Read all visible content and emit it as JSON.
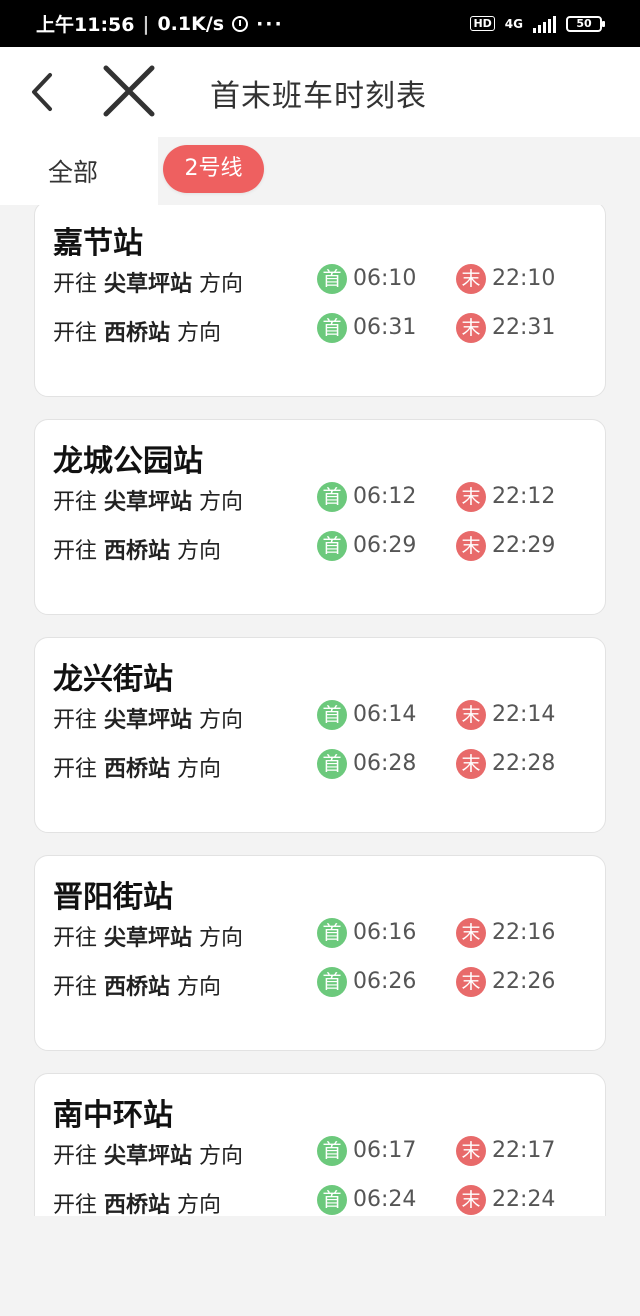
{
  "status_bar": {
    "time": "上午11:56",
    "speed": "0.1K/s",
    "dots": "···",
    "hd": "HD",
    "network": "4G",
    "battery": "50"
  },
  "header": {
    "title": "首末班车时刻表"
  },
  "tabs": [
    {
      "label": "全部",
      "active": false
    },
    {
      "label": "2号线",
      "active": true
    }
  ],
  "labels": {
    "toward": "开往",
    "direction": "方向",
    "first": "首",
    "last": "末"
  },
  "stations": [
    {
      "name": "嘉节站",
      "rows": [
        {
          "dest": "尖草坪站",
          "first": "06:10",
          "last": "22:10"
        },
        {
          "dest": "西桥站",
          "first": "06:31",
          "last": "22:31"
        }
      ]
    },
    {
      "name": "龙城公园站",
      "rows": [
        {
          "dest": "尖草坪站",
          "first": "06:12",
          "last": "22:12"
        },
        {
          "dest": "西桥站",
          "first": "06:29",
          "last": "22:29"
        }
      ]
    },
    {
      "name": "龙兴街站",
      "rows": [
        {
          "dest": "尖草坪站",
          "first": "06:14",
          "last": "22:14"
        },
        {
          "dest": "西桥站",
          "first": "06:28",
          "last": "22:28"
        }
      ]
    },
    {
      "name": "晋阳街站",
      "rows": [
        {
          "dest": "尖草坪站",
          "first": "06:16",
          "last": "22:16"
        },
        {
          "dest": "西桥站",
          "first": "06:26",
          "last": "22:26"
        }
      ]
    },
    {
      "name": "南中环站",
      "rows": [
        {
          "dest": "尖草坪站",
          "first": "06:17",
          "last": "22:17"
        },
        {
          "dest": "西桥站",
          "first": "06:24",
          "last": "22:24"
        }
      ]
    }
  ],
  "colors": {
    "accent": "#ee6060",
    "first_badge": "#6cc97c",
    "last_badge": "#e86a6a"
  }
}
